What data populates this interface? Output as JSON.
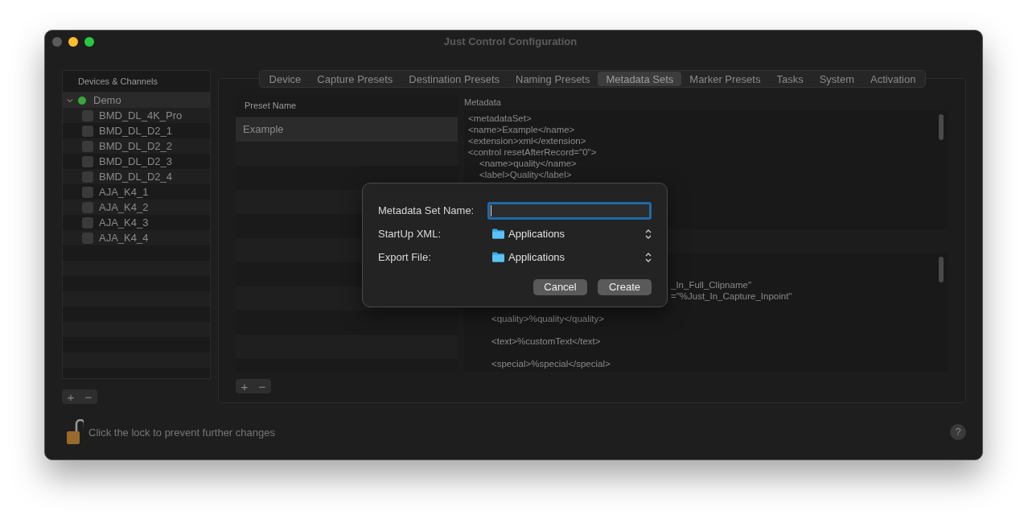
{
  "window": {
    "title": "Just Control Configuration"
  },
  "sidebar": {
    "header": "Devices & Channels",
    "device": {
      "name": "Demo",
      "expanded": true,
      "color": "#3ca53c"
    },
    "channels": [
      {
        "name": "BMD_DL_4K_Pro",
        "checked": false
      },
      {
        "name": "BMD_DL_D2_1",
        "checked": false
      },
      {
        "name": "BMD_DL_D2_2",
        "checked": false
      },
      {
        "name": "BMD_DL_D2_3",
        "checked": false
      },
      {
        "name": "BMD_DL_D2_4",
        "checked": false
      },
      {
        "name": "AJA_K4_1",
        "checked": false
      },
      {
        "name": "AJA_K4_2",
        "checked": false
      },
      {
        "name": "AJA_K4_3",
        "checked": false
      },
      {
        "name": "AJA_K4_4",
        "checked": false
      }
    ],
    "add": "+",
    "remove": "−"
  },
  "tabs": [
    {
      "label": "Device",
      "selected": false
    },
    {
      "label": "Capture Presets",
      "selected": false
    },
    {
      "label": "Destination Presets",
      "selected": false
    },
    {
      "label": "Naming Presets",
      "selected": false
    },
    {
      "label": "Metadata Sets",
      "selected": true
    },
    {
      "label": "Marker Presets",
      "selected": false
    },
    {
      "label": "Tasks",
      "selected": false
    },
    {
      "label": "System",
      "selected": false
    },
    {
      "label": "Activation",
      "selected": false
    }
  ],
  "presets": {
    "column": "Preset Name",
    "rows": [
      {
        "name": "Example",
        "selected": true
      }
    ],
    "add": "+",
    "remove": "−"
  },
  "metadata": {
    "label": "Metadata",
    "top_lines": [
      {
        "text": "<metadataSet>",
        "kind": "plain"
      },
      {
        "text": "<name>Example</name>",
        "kind": "plain"
      },
      {
        "text": "<extension>xml</extension>",
        "kind": "plain"
      },
      {
        "text": "<control resetAfterRecord=\"0\">",
        "kind": "plain"
      },
      {
        "text": "<name>quality</name>",
        "kind": "indent"
      },
      {
        "text": "<label>Quality</label>",
        "kind": "indent"
      }
    ],
    "bottom_lines": [
      {
        "text": "_In_Full_Clipname\"",
        "kind": "fragment"
      },
      {
        "text": "=\"%Just_In_Capture_Inpoint\"",
        "kind": "fragment"
      },
      {
        "kind": "gap"
      },
      {
        "text": "<quality>%quality</quality>",
        "kind": "body"
      },
      {
        "text": "<text>%customText</text>",
        "kind": "body"
      },
      {
        "text": "<special>%special</special>",
        "kind": "body"
      }
    ]
  },
  "dialog": {
    "fields": [
      {
        "label": "Metadata Set Name:",
        "kind": "text"
      },
      {
        "label": "StartUp XML:",
        "kind": "popup",
        "value": "Applications"
      },
      {
        "label": "Export File:",
        "kind": "popup",
        "value": "Applications"
      }
    ],
    "buttons": [
      "Cancel",
      "Create"
    ]
  },
  "footer": {
    "lock_text": "Click the lock to prevent further changes",
    "locked": false,
    "help": "?"
  }
}
